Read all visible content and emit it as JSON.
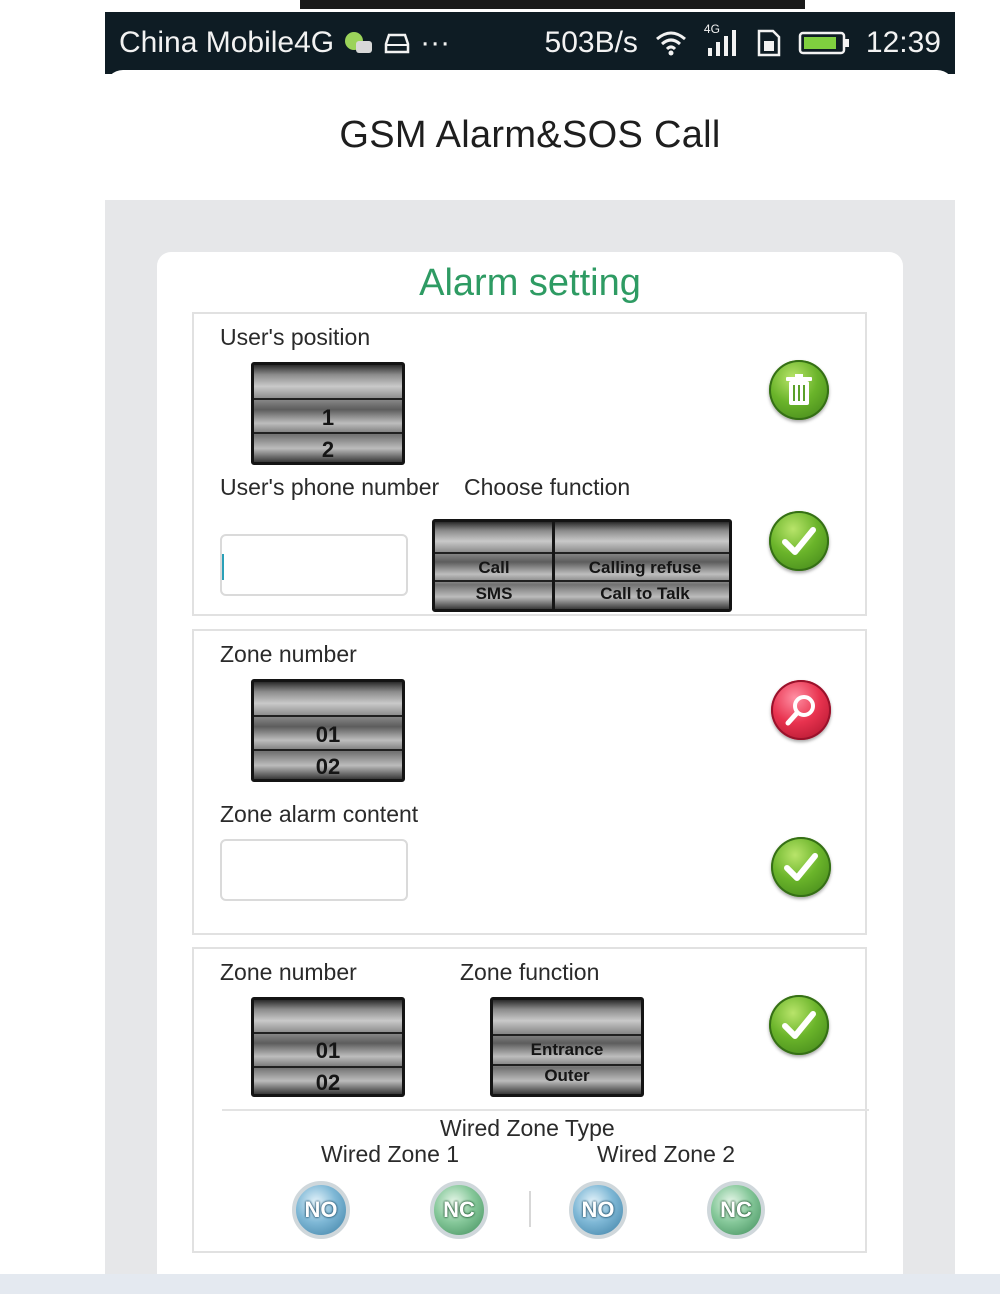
{
  "status_bar": {
    "carrier": "China Mobile4G",
    "more": "···",
    "speed": "503B/s",
    "network_type": "4G",
    "time": "12:39"
  },
  "app": {
    "title": "GSM Alarm&SOS Call"
  },
  "alarm_setting": {
    "title": "Alarm setting",
    "user_section": {
      "position_label": "User's position",
      "position_values": [
        "1",
        "2"
      ],
      "phone_label": "User's phone number",
      "phone_value": "",
      "function_label": "Choose function",
      "function_left": [
        "Call",
        "SMS"
      ],
      "function_right": [
        "Calling refuse",
        "Call to Talk"
      ]
    },
    "zone_section": {
      "zone_label": "Zone number",
      "zone_values": [
        "01",
        "02"
      ],
      "content_label": "Zone alarm content",
      "content_value": ""
    },
    "zone_function_section": {
      "zone_label": "Zone number",
      "zone_values": [
        "01",
        "02"
      ],
      "function_label": "Zone function",
      "function_values": [
        "Entrance",
        "Outer"
      ],
      "wired_type_label": "Wired Zone Type",
      "wired_zone_1": "Wired Zone 1",
      "wired_zone_2": "Wired Zone 2",
      "no_label": "NO",
      "nc_label": "NC"
    }
  },
  "colors": {
    "status_bar": "#0e1c24",
    "accent_green": "#2e9b63",
    "button_green": "#6ab42a",
    "button_red": "#e8334f",
    "background": "#e6e7e9"
  },
  "icons": {
    "delete": "trash-icon",
    "confirm": "checkmark-icon",
    "search": "magnifier-icon"
  }
}
